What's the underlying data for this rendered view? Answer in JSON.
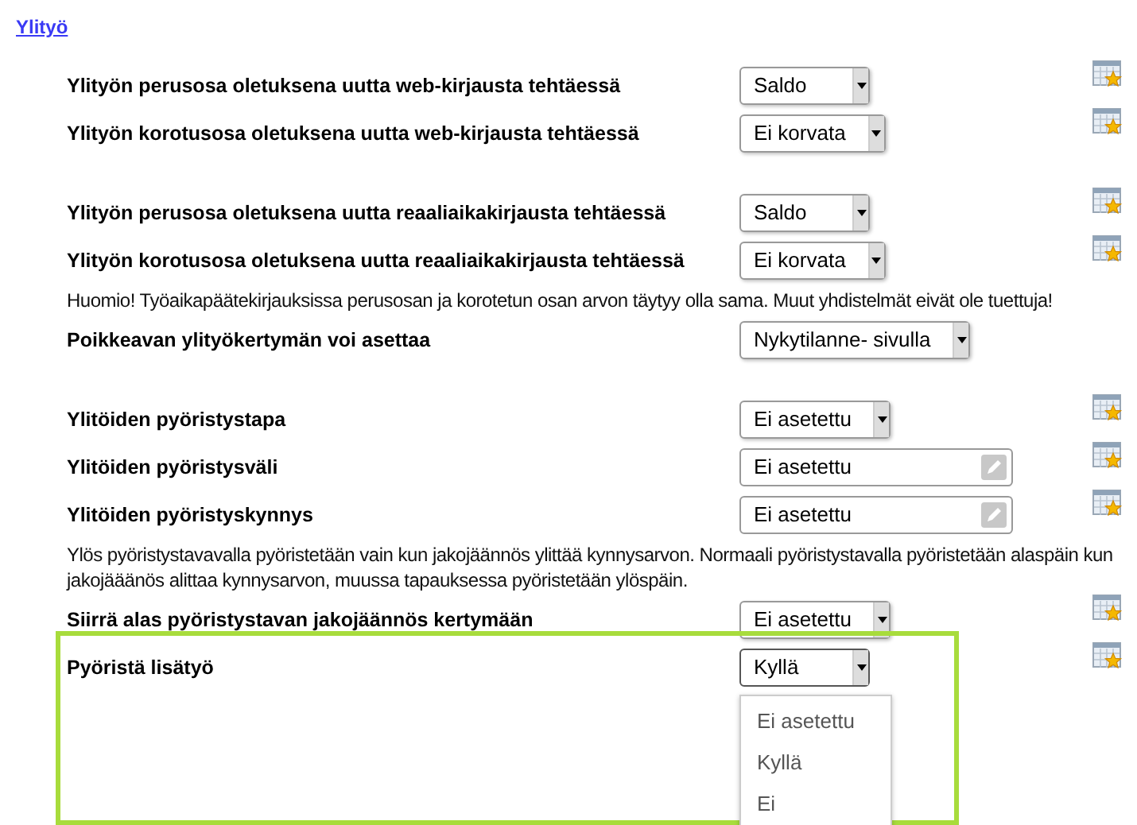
{
  "title": "Ylityö",
  "sections": [
    {
      "rows": [
        {
          "kind": "select",
          "label": "Ylityön perusosa oletuksena uutta web-kirjausta tehtäessä",
          "value": "Saldo",
          "calendar_icon": true
        },
        {
          "kind": "select",
          "label": "Ylityön korotusosa oletuksena uutta web-kirjausta tehtäessä",
          "value": "Ei korvata",
          "calendar_icon": true
        }
      ]
    },
    {
      "rows": [
        {
          "kind": "select",
          "label": "Ylityön perusosa oletuksena uutta reaaliaikakirjausta tehtäessä",
          "value": "Saldo",
          "calendar_icon": true
        },
        {
          "kind": "select",
          "label": "Ylityön korotusosa oletuksena uutta reaaliaikakirjausta tehtäessä",
          "value": "Ei korvata",
          "calendar_icon": true
        },
        {
          "kind": "note",
          "text": "Huomio! Työaikapäätekirjauksissa perusosan ja korotetun osan arvon täytyy olla sama. Muut yhdistelmät eivät ole tuettuja!"
        },
        {
          "kind": "select",
          "label": "Poikkeavan ylityökertymän voi asettaa",
          "value": "Nykytilanne- sivulla",
          "calendar_icon": false
        }
      ]
    },
    {
      "rows": [
        {
          "kind": "select",
          "label": "Ylitöiden pyöristystapa",
          "value": "Ei asetettu",
          "calendar_icon": true
        },
        {
          "kind": "text",
          "label": "Ylitöiden pyöristysväli",
          "value": "Ei asetettu",
          "calendar_icon": true
        },
        {
          "kind": "text",
          "label": "Ylitöiden pyöristyskynnys",
          "value": "Ei asetettu",
          "calendar_icon": true
        },
        {
          "kind": "note",
          "text": "Ylös pyöristystavavalla pyöristetään vain kun jakojäännös ylittää kynnysarvon. Normaali pyöristystavalla pyöristetään alaspäin kun jakojääänös alittaa kynnysarvon, muussa tapauksessa pyöristetään ylöspäin."
        },
        {
          "kind": "select",
          "label": "Siirrä alas pyöristystavan jakojäännös kertymään",
          "value": "Ei asetettu",
          "calendar_icon": true
        },
        {
          "kind": "select",
          "label": "Pyöristä lisätyö",
          "value": "Kyllä",
          "calendar_icon": true,
          "highlighted": true,
          "expanded": true,
          "options": [
            "Ei asetettu",
            "Kyllä",
            "Ei"
          ]
        }
      ]
    }
  ]
}
